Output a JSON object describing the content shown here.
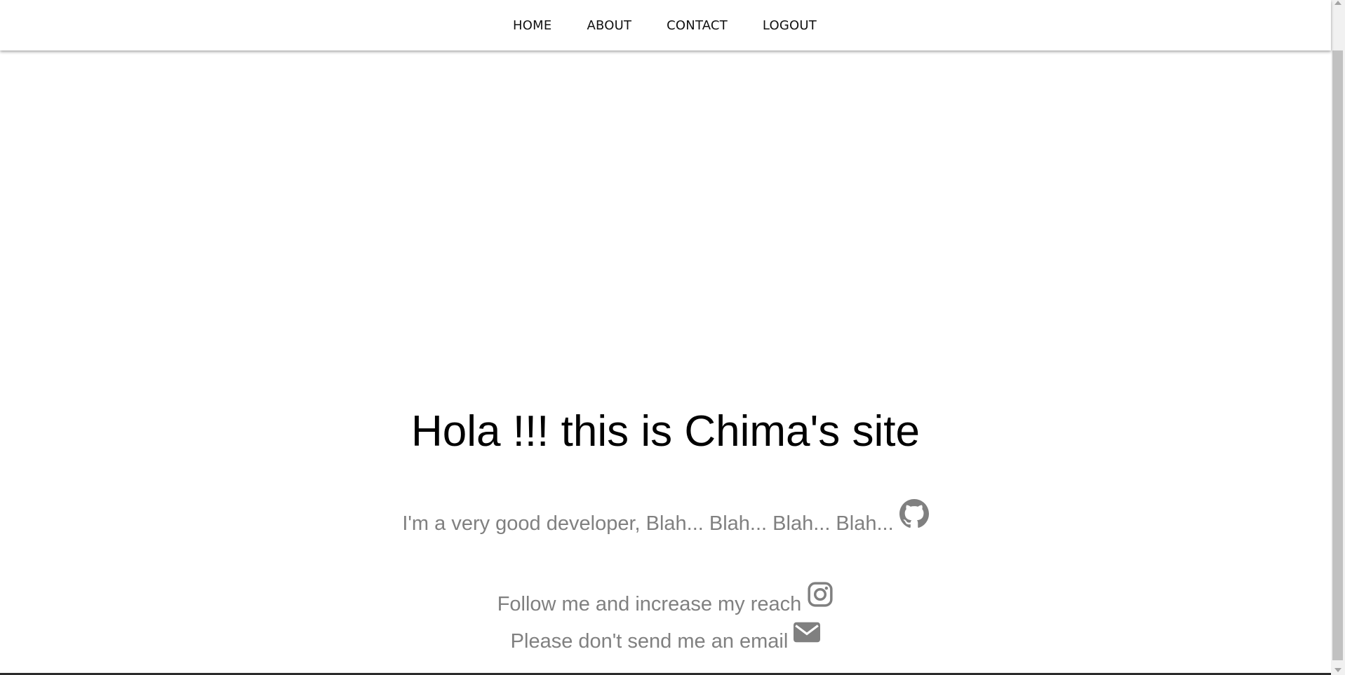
{
  "nav": {
    "items": [
      {
        "label": "HOME"
      },
      {
        "label": "ABOUT"
      },
      {
        "label": "CONTACT"
      },
      {
        "label": "LOGOUT"
      }
    ]
  },
  "hero": {
    "title": "Hola !!! this is Chima's site",
    "developer_line": "I'm a very good developer, Blah... Blah... Blah... Blah...",
    "follow_line": "Follow me and increase my reach",
    "email_line": "Please don't send me an email"
  },
  "icons": {
    "github": "github-icon",
    "instagram": "instagram-icon",
    "email": "envelope-icon"
  },
  "colors": {
    "text_primary": "#000000",
    "text_muted": "#808080",
    "background": "#ffffff"
  }
}
